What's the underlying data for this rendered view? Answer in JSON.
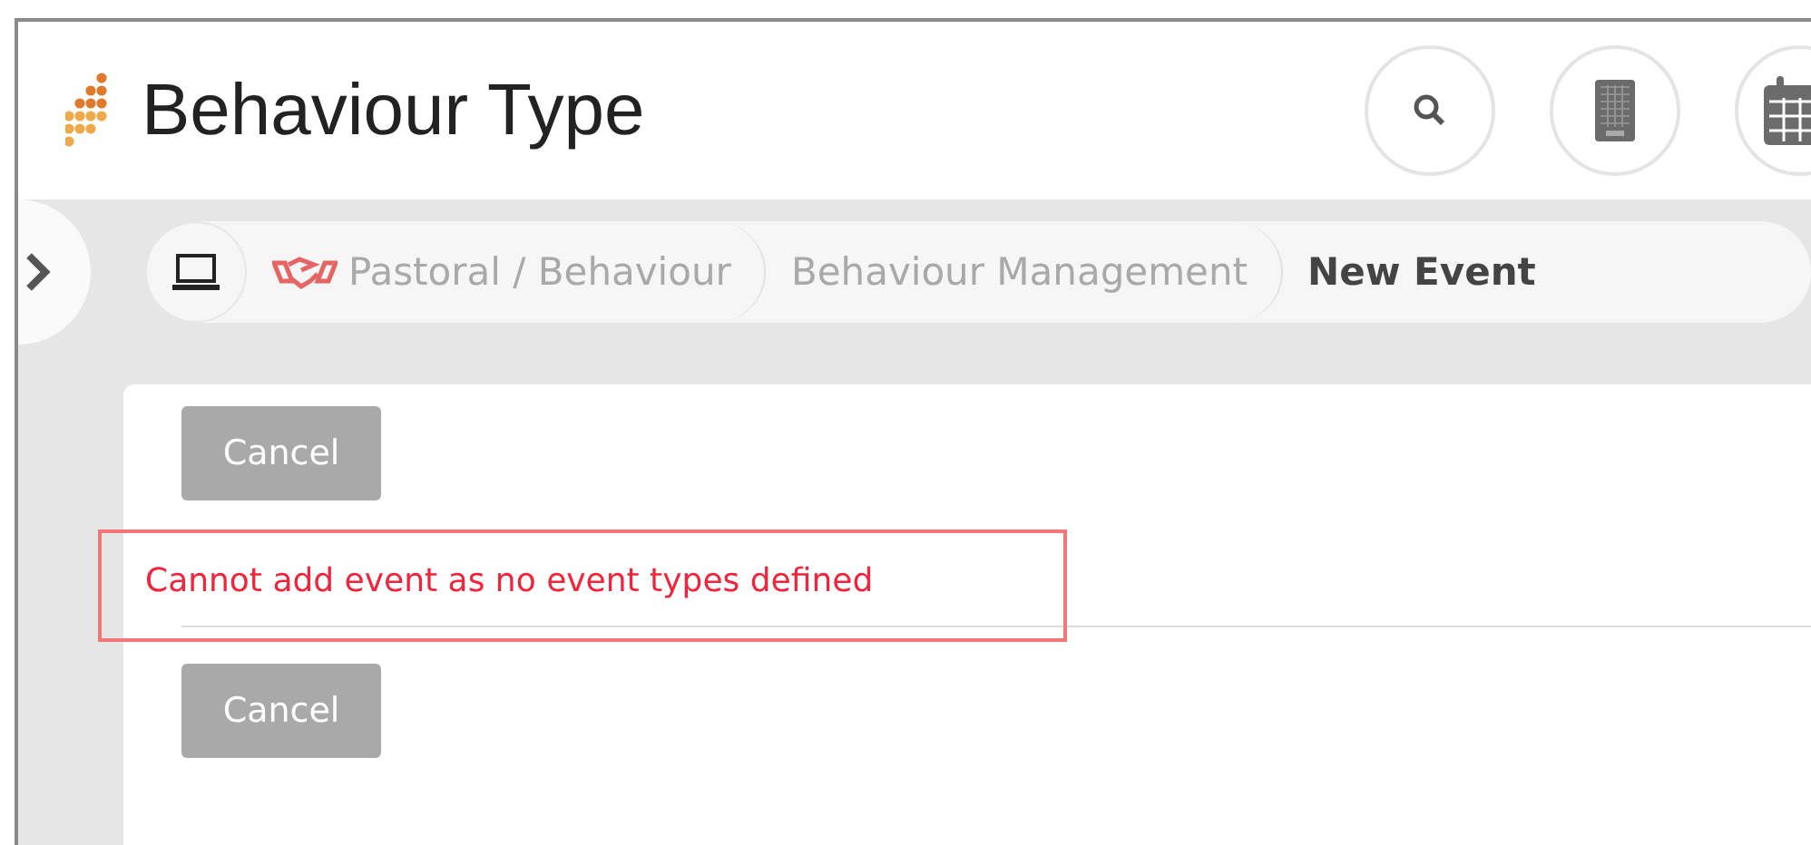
{
  "header": {
    "title": "Behaviour Type",
    "actions": [
      {
        "kind": "search"
      },
      {
        "kind": "phone"
      },
      {
        "kind": "calendar"
      }
    ]
  },
  "breadcrumbs": [
    {
      "kind": "home"
    },
    {
      "kind": "section",
      "label": "Pastoral / Behaviour",
      "current": false
    },
    {
      "kind": "page",
      "label": "Behaviour Management",
      "current": false
    },
    {
      "kind": "page",
      "label": "New Event",
      "current": true
    }
  ],
  "form": {
    "top_button": "Cancel",
    "message": "Cannot add event as no event types defined",
    "message_highlighted": true,
    "bottom_button": "Cancel"
  }
}
